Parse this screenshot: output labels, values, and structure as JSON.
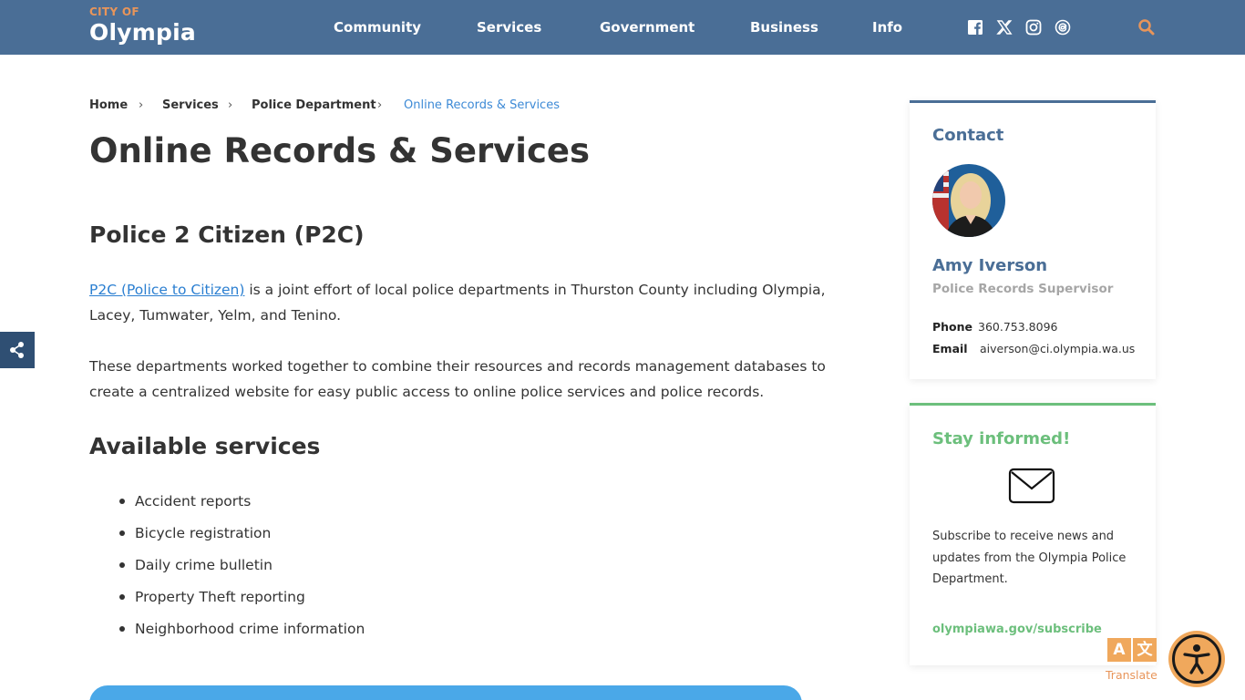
{
  "header": {
    "logo_small": "CITY OF",
    "logo_big": "Olympia",
    "nav": [
      "Community",
      "Services",
      "Government",
      "Business",
      "Info"
    ],
    "social_icons": [
      "facebook-icon",
      "x-icon",
      "instagram-icon",
      "threads-icon"
    ],
    "colors": {
      "bar": "#4a6e96",
      "accent": "#e8955a"
    }
  },
  "breadcrumb": [
    "Home",
    "Services",
    "Police Department",
    "Online Records & Services"
  ],
  "page": {
    "title": "Online Records & Services",
    "section1_heading": "Police 2 Citizen (P2C)",
    "p1_link": "P2C (Police to Citizen)",
    "p1_text": " is a joint effort of local police departments in Thurston County including Olympia, Lacey, Tumwater, Yelm, and Tenino.",
    "p2_text": "These departments worked together to combine their resources and records management databases to create a centralized website for easy public access to online police services and police records.",
    "section2_heading": "Available services",
    "services": [
      "Accident reports",
      "Bicycle registration",
      "Daily crime bulletin",
      "Property Theft reporting",
      "Neighborhood crime information"
    ]
  },
  "contact": {
    "heading": "Contact",
    "name": "Amy Iverson",
    "role": "Police Records Supervisor",
    "phone_label": "Phone",
    "phone": "360.753.8096",
    "email_label": "Email",
    "email": "aiverson@ci.olympia.wa.us"
  },
  "stay": {
    "heading": "Stay informed!",
    "text": "Subscribe to receive news and updates from the Olympia Police Department.",
    "link": "olympiawa.gov/subscribe",
    "color": "#6cbf7c"
  },
  "widgets": {
    "translate_label": "Translate",
    "translate_glyphs": [
      "A",
      "文"
    ]
  }
}
